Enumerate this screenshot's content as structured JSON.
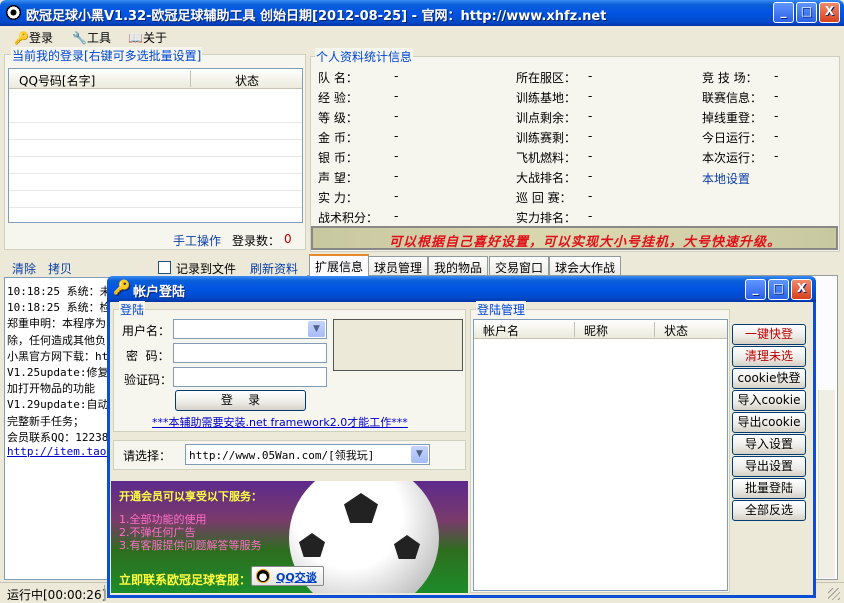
{
  "window": {
    "title": "欧冠足球小黑V1.32-欧冠足球辅助工具 创始日期[2012-08-25] - 官网：http://www.xhfz.net",
    "min": "_",
    "max": "□",
    "close": "X"
  },
  "menu": {
    "login": "登录",
    "tools": "工具",
    "about": "关于"
  },
  "accounts": {
    "legend": "当前我的登录[右键可多选批量设置]",
    "col_qq": "QQ号码[名字]",
    "col_status": "状态",
    "manual": "手工操作",
    "count_label": "登录数：",
    "count": "0"
  },
  "profile": {
    "legend": "个人资料统计信息",
    "col1": [
      {
        "label": "队 名：",
        "value": "-"
      },
      {
        "label": "经 验：",
        "value": "-"
      },
      {
        "label": "等 级：",
        "value": "-"
      },
      {
        "label": "金 币：",
        "value": "-"
      },
      {
        "label": "银 币：",
        "value": "-"
      },
      {
        "label": "声 望：",
        "value": "-"
      },
      {
        "label": "实 力：",
        "value": "-"
      },
      {
        "label": "战术积分：",
        "value": "-"
      }
    ],
    "col2": [
      {
        "label": "所在服区：",
        "value": "-"
      },
      {
        "label": "训练基地：",
        "value": "-"
      },
      {
        "label": "训点剩余：",
        "value": "-"
      },
      {
        "label": "训练赛剩：",
        "value": "-"
      },
      {
        "label": "飞机燃料：",
        "value": "-"
      },
      {
        "label": "大战排名：",
        "value": "-"
      },
      {
        "label": "巡 回 赛：",
        "value": "-"
      },
      {
        "label": "实力排名：",
        "value": "-"
      }
    ],
    "col3": [
      {
        "label": "竞 技 场：",
        "value": "-"
      },
      {
        "label": "联赛信息：",
        "value": "-"
      },
      {
        "label": "掉线重登：",
        "value": "-"
      },
      {
        "label": "今日运行：",
        "value": "-"
      },
      {
        "label": "本次运行：",
        "value": "-"
      }
    ],
    "local_settings": "本地设置",
    "banner": "可以根据自己喜好设置，可以实现大小号挂机，大号快速升级。"
  },
  "log": {
    "clear": "清除",
    "copy": "拷贝",
    "record": "记录到文件",
    "refresh": "刷新资料",
    "lines": [
      "10:18:25 系统：未",
      "10:18:25 系统：检",
      "郑重申明：本程序为",
      "除，任何造成其他负",
      "小黑官方网下载：ht",
      "V1.25update:修复冒",
      "加打开物品的功能",
      "V1.29update:自动拍",
      "完整新手任务；",
      "会员联系QQ：12238",
      "http://item.taob"
    ]
  },
  "tabs": [
    "扩展信息",
    "球员管理",
    "我的物品",
    "交易窗口",
    "球会大作战"
  ],
  "status": {
    "running": "运行中[00:00:26]"
  },
  "dialog": {
    "title": "帐户登陆",
    "login_legend": "登陆",
    "username_label": "用户名：",
    "password_label": "密  码：",
    "captcha_label": "验证码：",
    "login_button": "登    录",
    "framework_note": "***本辅助需要安装.net framework2.0才能工作***",
    "choose_label": "请选择：",
    "server_selected": "http://www.05Wan.com/[领我玩]",
    "mgmt_legend": "登陆管理",
    "col_account": "帐户名",
    "col_nick": "昵称",
    "col_status": "状态",
    "buttons": [
      "一键快登",
      "清理未选",
      "cookie快登",
      "导入cookie",
      "导出cookie",
      "导入设置",
      "导出设置",
      "批量登陆",
      "全部反选"
    ],
    "promo_title": "开通会员可以享受以下服务：",
    "promo_items": [
      "1.全部功能的使用",
      "2.不弹任何广告",
      "3.有客服提供问题解答等服务"
    ],
    "promo_contact": "立即联系欧冠足球客服：",
    "qq_button": "QQ交谈"
  }
}
